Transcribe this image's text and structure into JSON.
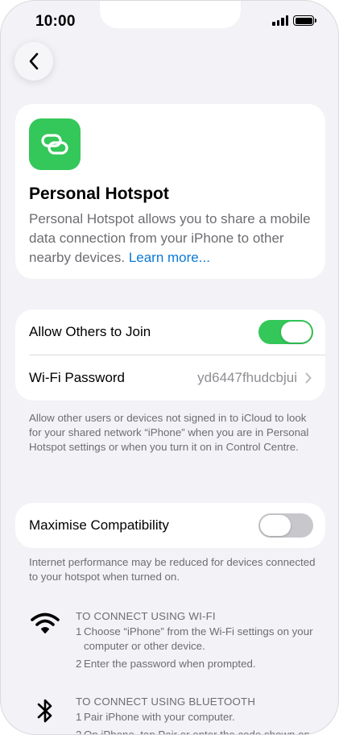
{
  "status": {
    "time": "10:00"
  },
  "hero": {
    "icon": "link-icon",
    "title": "Personal Hotspot",
    "description": "Personal Hotspot allows you to share a mobile data connection from your iPhone to other nearby devices.",
    "link": "Learn more..."
  },
  "settings": {
    "allow_label": "Allow Others to Join",
    "allow_on": true,
    "password_label": "Wi-Fi Password",
    "password_value": "yd6447fhudcbjui"
  },
  "footnote1": "Allow other users or devices not signed in to iCloud to look for your shared network “iPhone” when you are in Personal Hotspot settings or when you turn it on in Control Centre.",
  "compat": {
    "label": "Maximise Compatibility",
    "on": false
  },
  "footnote2": "Internet performance may be reduced for devices connected to your hotspot when turned on.",
  "wifi": {
    "title": "TO CONNECT USING WI-FI",
    "step1_num": "1",
    "step1": "Choose “iPhone” from the Wi-Fi settings on your computer or other device.",
    "step2_num": "2",
    "step2": "Enter the password when prompted."
  },
  "bluetooth": {
    "title": "TO CONNECT USING BLUETOOTH",
    "step1_num": "1",
    "step1": "Pair iPhone with your computer.",
    "step2_num": "2",
    "step2": "On iPhone, tap Pair or enter the code shown on your computer."
  },
  "colors": {
    "accent": "#34c759",
    "link": "#0a7ad6",
    "background": "#f2f2f7"
  }
}
